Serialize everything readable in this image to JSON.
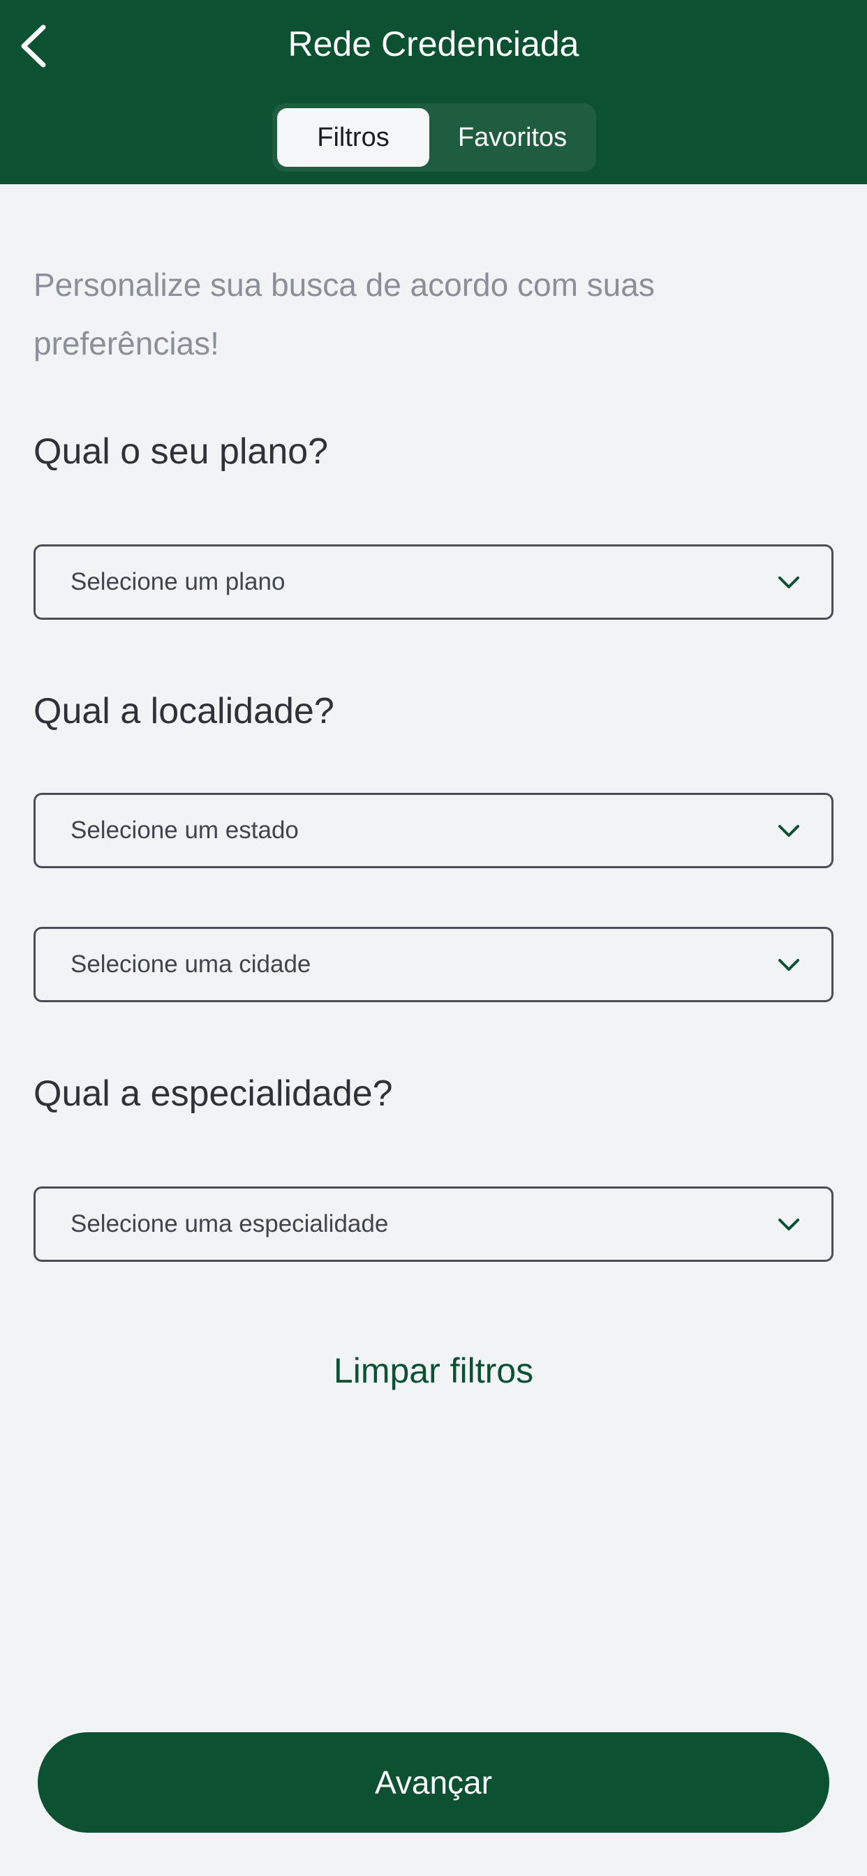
{
  "header": {
    "title": "Rede Credenciada",
    "back_icon": "chevron-left-icon",
    "tabs": [
      {
        "label": "Filtros",
        "active": true
      },
      {
        "label": "Favoritos",
        "active": false
      }
    ]
  },
  "intro": "Personalize sua busca de acordo com suas preferências!",
  "sections": {
    "plano": {
      "title": "Qual o seu plano?",
      "select_placeholder": "Selecione um plano"
    },
    "localidade": {
      "title": "Qual a localidade?",
      "estado_placeholder": "Selecione um estado",
      "cidade_placeholder": "Selecione uma cidade"
    },
    "especialidade": {
      "title": "Qual a especialidade?",
      "select_placeholder": "Selecione uma especialidade"
    }
  },
  "clear_label": "Limpar filtros",
  "primary_label": "Avançar",
  "colors": {
    "brand": "#0b5132",
    "background": "#f2f3f5",
    "muted_text": "#8a8f98"
  }
}
